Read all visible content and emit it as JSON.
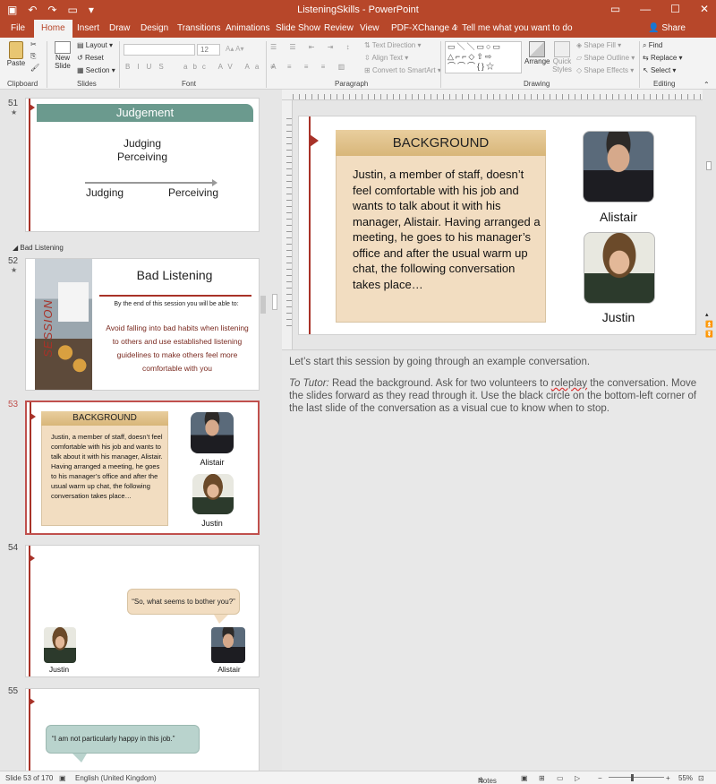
{
  "window": {
    "title": "ListeningSkills  -  PowerPoint",
    "controls": [
      "—",
      "☐",
      "✕"
    ]
  },
  "tabs": [
    {
      "label": "File"
    },
    {
      "label": "Home"
    },
    {
      "label": "Insert"
    },
    {
      "label": "Draw"
    },
    {
      "label": "Design"
    },
    {
      "label": "Transitions"
    },
    {
      "label": "Animations"
    },
    {
      "label": "Slide Show"
    },
    {
      "label": "Review"
    },
    {
      "label": "View"
    },
    {
      "label": "PDF-XChange 4"
    }
  ],
  "tell_me": "Tell me what you want to do",
  "share": "Share",
  "ribbon": {
    "clipboard": {
      "paste": "Paste",
      "label": "Clipboard"
    },
    "slides": {
      "new_slide": "New Slide",
      "layout": "Layout",
      "reset": "Reset",
      "section": "Section",
      "label": "Slides"
    },
    "font": {
      "size": "12",
      "label": "Font"
    },
    "paragraph": {
      "text_direction": "Text Direction",
      "align_text": "Align Text",
      "convert": "Convert to SmartArt",
      "label": "Paragraph"
    },
    "drawing": {
      "arrange": "Arrange",
      "quick_styles": "Quick Styles",
      "shape_fill": "Shape Fill",
      "shape_outline": "Shape Outline",
      "shape_effects": "Shape Effects",
      "label": "Drawing"
    },
    "editing": {
      "find": "Find",
      "replace": "Replace",
      "select": "Select",
      "label": "Editing"
    }
  },
  "thumbnails": {
    "s51": {
      "num": "51",
      "title": "Judgement",
      "line1": "Judging",
      "line2": "Perceiving",
      "left": "Judging",
      "right": "Perceiving"
    },
    "section": "Bad Listening",
    "s52": {
      "num": "52",
      "title": "Bad Listening",
      "session": "SESSION",
      "intro": "By the end of this session you will be able to:",
      "body": "Avoid falling into bad habits when listening to others and use established listening guidelines to make others feel more comfortable with you"
    },
    "s53": {
      "num": "53"
    },
    "s54": {
      "num": "54",
      "bubble": "“So, what seems to bother you?”",
      "left_name": "Justin",
      "right_name": "Alistair"
    },
    "s55": {
      "num": "55",
      "bubble": "“I am not particularly happy in this job.”"
    }
  },
  "slide": {
    "heading": "BACKGROUND",
    "text": "Justin, a member of staff, doesn’t feel comfortable with his job and wants to talk about it with his manager, Alistair. Having arranged a meeting, he goes to his manager’s office and after the usual warm up chat, the following conversation takes place…",
    "person1": "Alistair",
    "person2": "Justin"
  },
  "notes": {
    "p1": "Let’s start this session by going through an example conversation.",
    "tutor_label": "To Tutor:",
    "p2a": " Read the background.  Ask for two volunteers to ",
    "p2_squiggle": "roleplay",
    "p2b": " the conversation. Move the slides forward as they read through it. Use the black circle on the bottom-left corner of the last slide of the conversation as a visual cue to know when to stop."
  },
  "status": {
    "slide_count": "Slide 53 of 170",
    "language": "English (United Kingdom)",
    "notes": "Notes",
    "zoom": "55%"
  }
}
